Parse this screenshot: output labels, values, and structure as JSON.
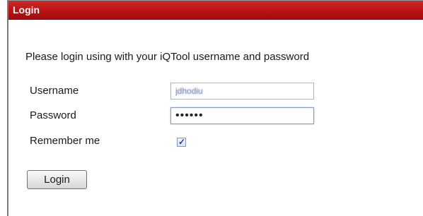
{
  "window": {
    "title": "Login"
  },
  "form": {
    "instruction": "Please login using with your iQTool username and password",
    "username_label": "Username",
    "username_value": "jdhodiu",
    "password_label": "Password",
    "password_value": "••••••",
    "remember_label": "Remember me",
    "remember_checked": true,
    "remember_mark": "✓",
    "login_button_label": "Login"
  },
  "colors": {
    "titlebar": "#b81414",
    "titlebar_text": "#ffffff",
    "focus_border": "#7f9db9"
  }
}
